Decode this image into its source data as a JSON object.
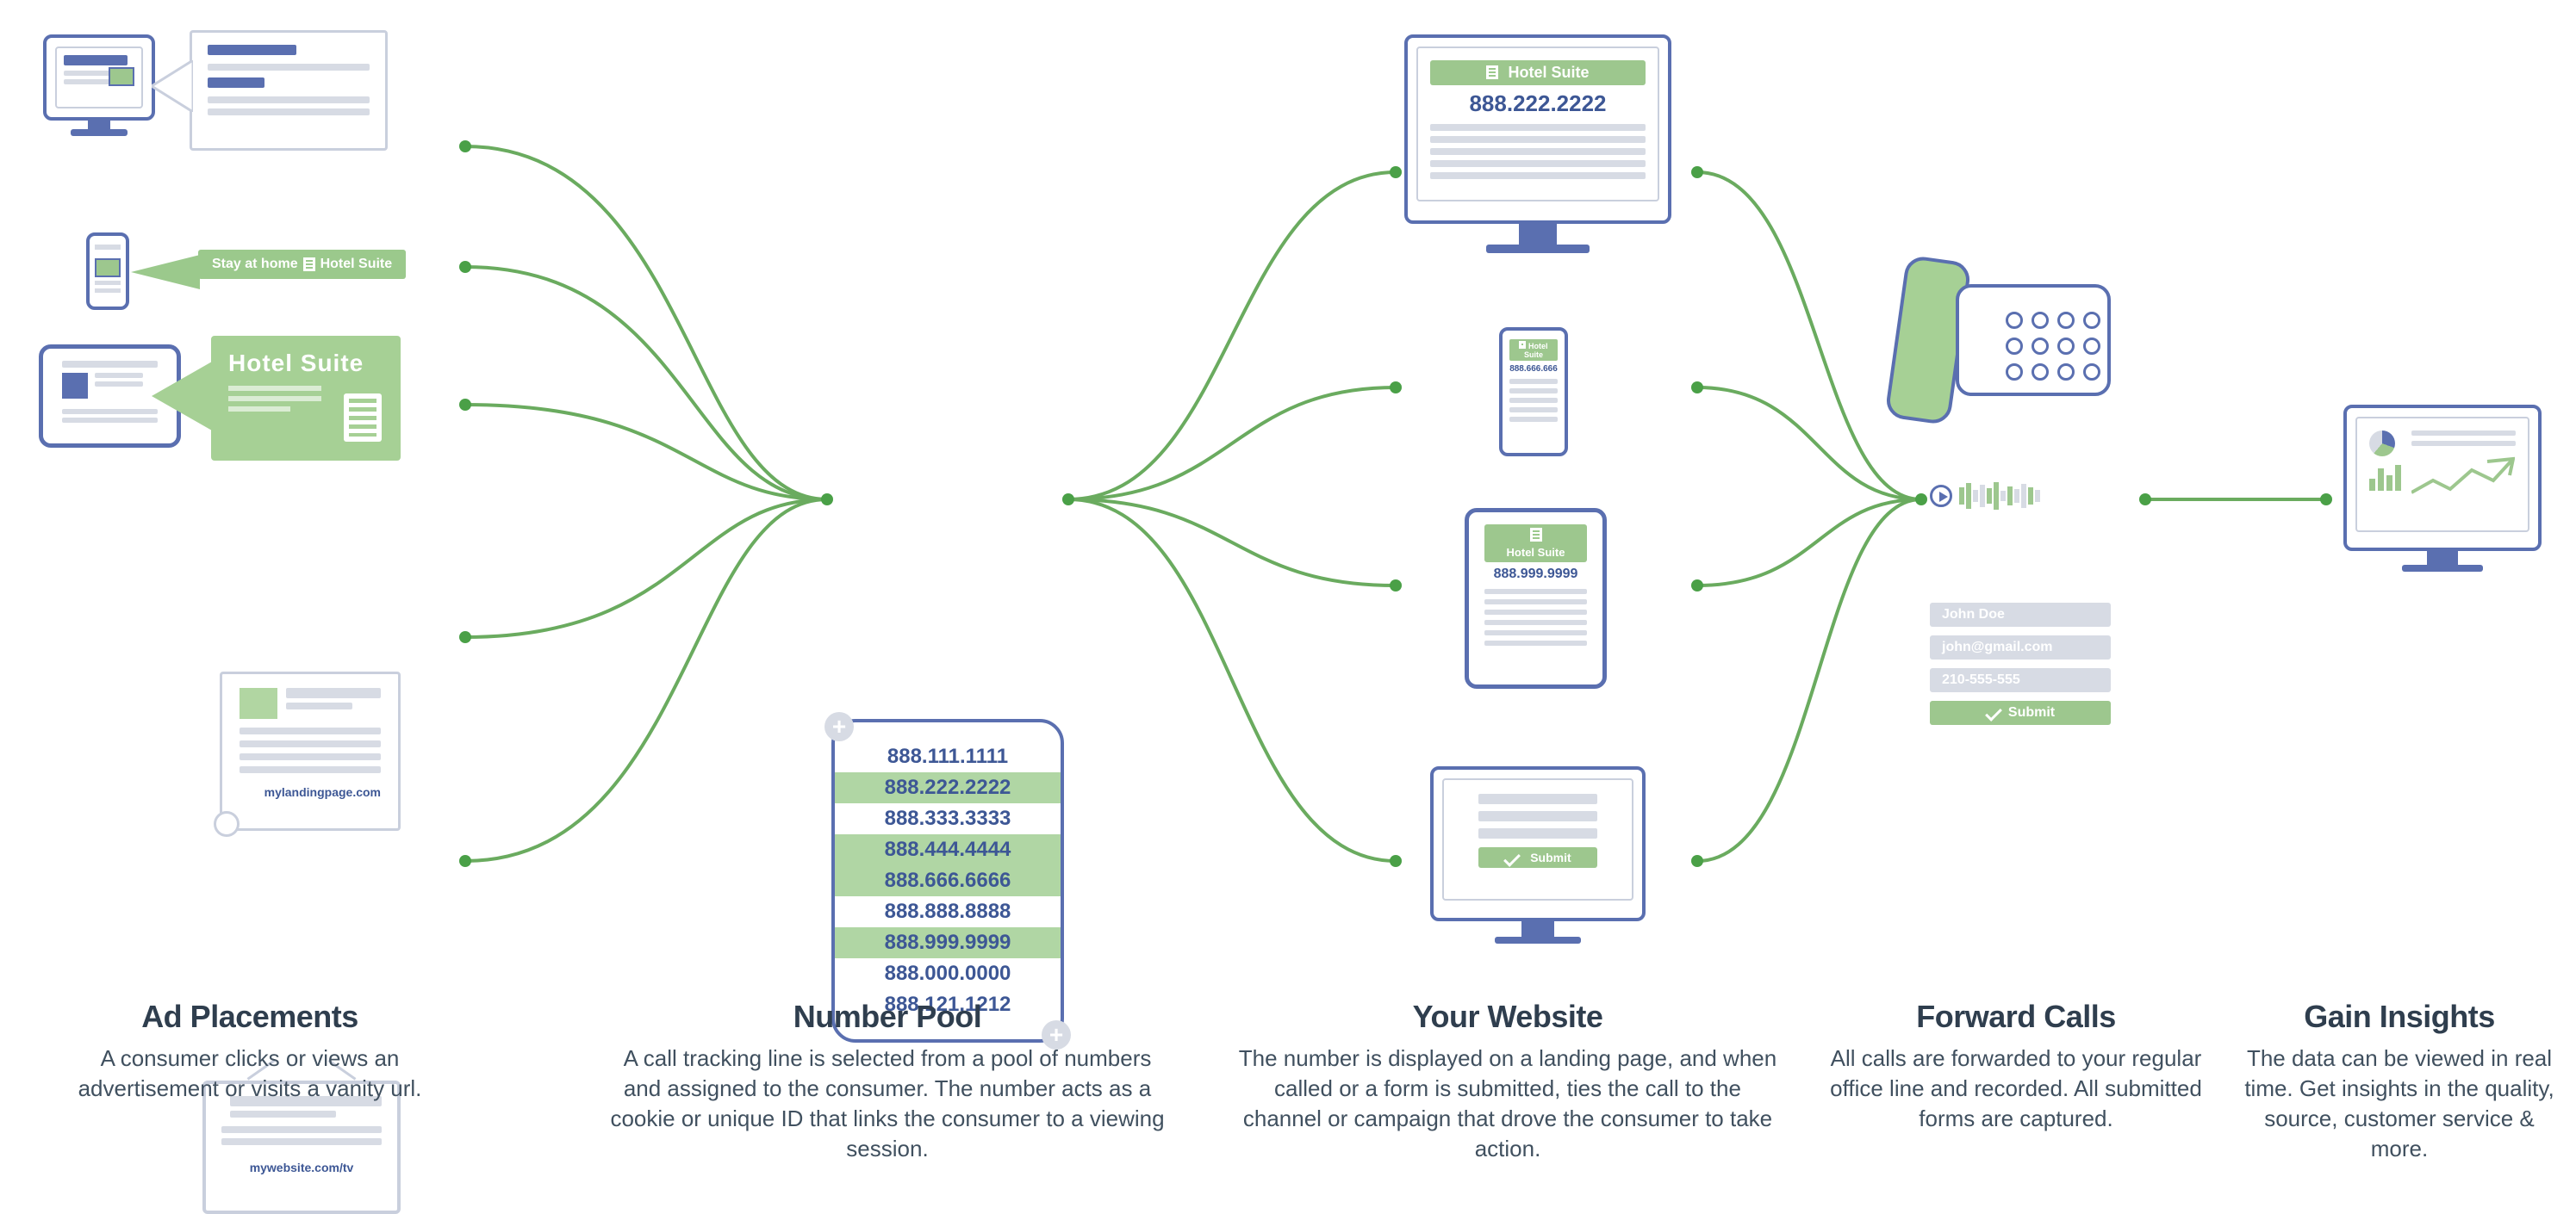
{
  "columns": [
    {
      "title": "Ad Placements",
      "body": "A consumer clicks or views an advertisement or visits a vanity url."
    },
    {
      "title": "Number Pool",
      "body": "A call tracking line is selected from a pool of numbers and assigned to the consumer. The number acts as a cookie or unique ID that links the consumer to a viewing session."
    },
    {
      "title": "Your Website",
      "body": "The number is displayed on a landing page, and when called or a form is submitted, ties the call to the channel or campaign that drove the consumer to take action."
    },
    {
      "title": "Forward Calls",
      "body": "All calls are forwarded to your regular office line and recorded. All submitted forms are captured."
    },
    {
      "title": "Gain Insights",
      "body": "The data can be viewed in real time. Get insights in the quality, source, customer service & more."
    }
  ],
  "ads": {
    "mobile_banner": "Stay at home",
    "brand_name": "Hotel Suite",
    "lp_url": "mylandingpage.com",
    "tv_url": "mywebsite.com/tv"
  },
  "number_pool": [
    {
      "num": "888.111.1111",
      "hl": false
    },
    {
      "num": "888.222.2222",
      "hl": true
    },
    {
      "num": "888.333.3333",
      "hl": false
    },
    {
      "num": "888.444.4444",
      "hl": true
    },
    {
      "num": "888.666.6666",
      "hl": true
    },
    {
      "num": "888.888.8888",
      "hl": false
    },
    {
      "num": "888.999.9999",
      "hl": true
    },
    {
      "num": "888.000.0000",
      "hl": false
    },
    {
      "num": "888.121.1212",
      "hl": false
    }
  ],
  "website": {
    "desktop_number": "888.222.2222",
    "phone_number": "888.666.666",
    "tablet_number": "888.999.9999"
  },
  "forward": {
    "form_name": "John Doe",
    "form_email": "john@gmail.com",
    "form_phone": "210-555-555",
    "submit": "Submit"
  },
  "submit_label": "Submit"
}
